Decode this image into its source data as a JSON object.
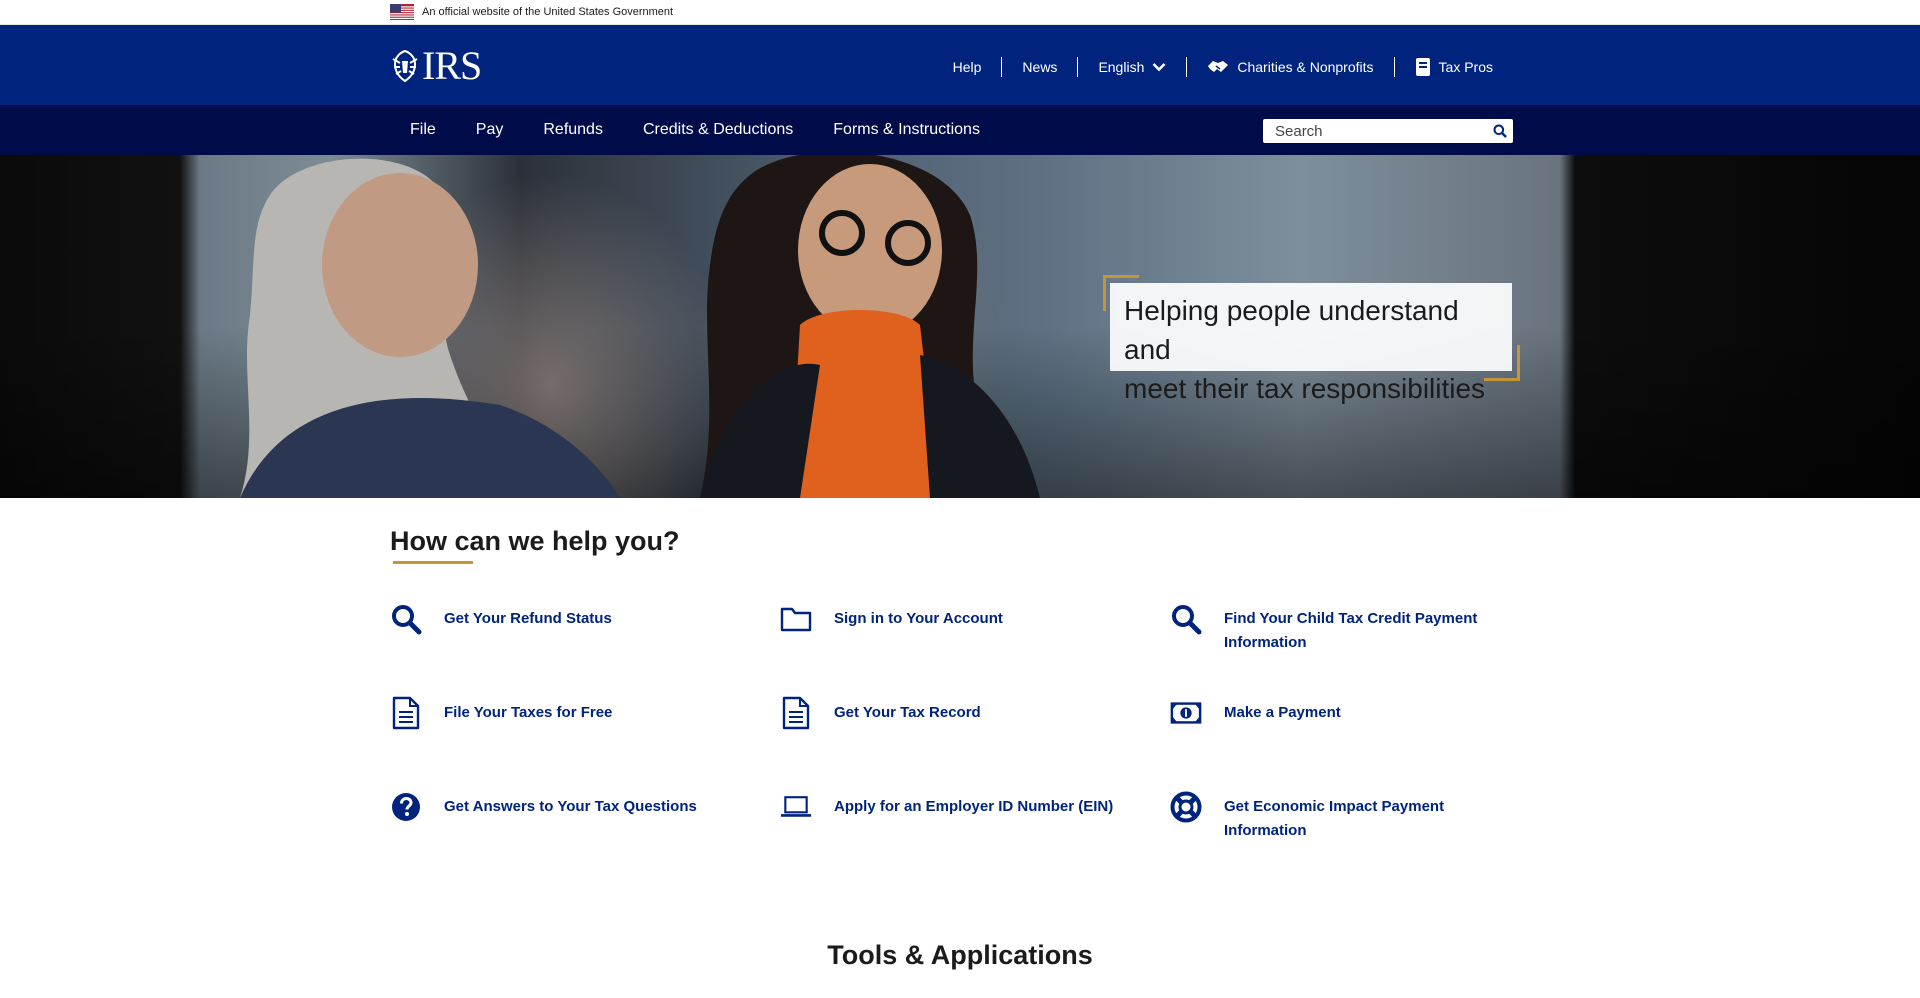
{
  "gov_banner": {
    "text": "An official website of the United States Government",
    "flag_icon": "us-flag-icon"
  },
  "header": {
    "logo_text": "IRS",
    "logo_icon": "irs-eagle-icon",
    "utility_nav": [
      {
        "label": "Help",
        "icon": ""
      },
      {
        "label": "News",
        "icon": ""
      },
      {
        "label": "English",
        "icon": "chevron-down-icon"
      },
      {
        "label": "Charities & Nonprofits",
        "icon": "handshake-icon"
      },
      {
        "label": "Tax Pros",
        "icon": "tax-pro-icon"
      }
    ]
  },
  "main_nav": {
    "items": [
      "File",
      "Pay",
      "Refunds",
      "Credits & Deductions",
      "Forms & Instructions"
    ],
    "search_placeholder": "Search",
    "search_icon": "search-icon"
  },
  "hero": {
    "caption_line1": "Helping people understand and",
    "caption_line2": "meet their tax responsibilities",
    "accent_color": "#c4963b"
  },
  "help": {
    "title": "How can we help you?",
    "links": [
      {
        "label": "Get Your Refund Status",
        "icon": "search-icon"
      },
      {
        "label": "Sign in to Your Account",
        "icon": "folder-icon"
      },
      {
        "label": "Find Your Child Tax Credit Payment Information",
        "icon": "search-icon"
      },
      {
        "label": "File Your Taxes for Free",
        "icon": "document-icon"
      },
      {
        "label": "Get Your Tax Record",
        "icon": "document-icon"
      },
      {
        "label": "Make a Payment",
        "icon": "money-icon"
      },
      {
        "label": "Get Answers to Your Tax Questions",
        "icon": "question-circle-icon"
      },
      {
        "label": "Apply for an Employer ID Number (EIN)",
        "icon": "laptop-icon"
      },
      {
        "label": "Get Economic Impact Payment Information",
        "icon": "life-ring-icon"
      }
    ]
  },
  "tools": {
    "title": "Tools & Applications"
  },
  "colors": {
    "header_blue": "#00247d",
    "nav_dark": "#000c4a",
    "link_blue": "#00247d",
    "gold": "#c4963b"
  }
}
